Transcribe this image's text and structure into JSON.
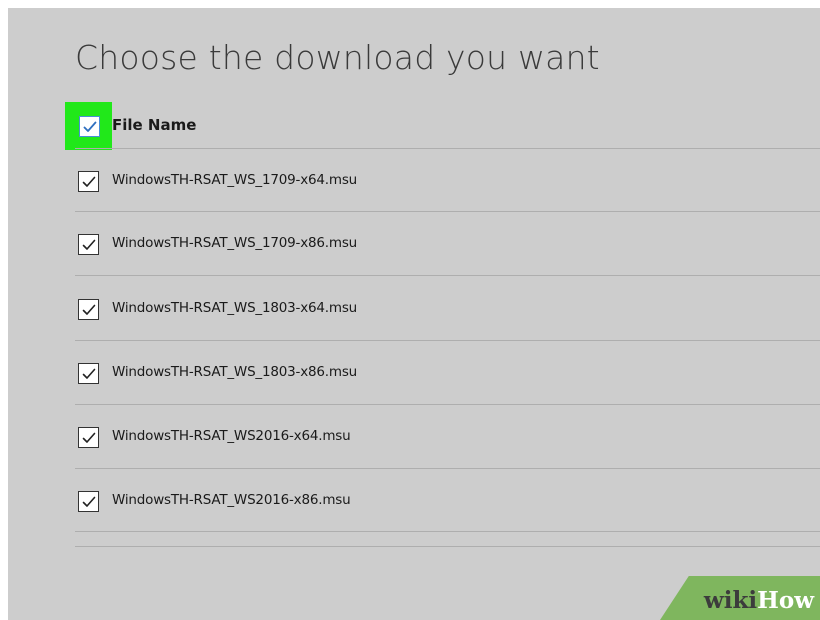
{
  "page": {
    "title": "Choose the download you want"
  },
  "table": {
    "header": {
      "label": "File Name",
      "checked": true
    },
    "rows": [
      {
        "label": "WindowsTH-RSAT_WS_1709-x64.msu",
        "checked": true
      },
      {
        "label": "WindowsTH-RSAT_WS_1709-x86.msu",
        "checked": true
      },
      {
        "label": "WindowsTH-RSAT_WS_1803-x64.msu",
        "checked": true
      },
      {
        "label": "WindowsTH-RSAT_WS_1803-x86.msu",
        "checked": true
      },
      {
        "label": "WindowsTH-RSAT_WS2016-x64.msu",
        "checked": true
      },
      {
        "label": "WindowsTH-RSAT_WS2016-x86.msu",
        "checked": true
      }
    ]
  },
  "watermark": {
    "part1": "wiki",
    "part2": "How"
  },
  "colors": {
    "panel_background": "#cdcdcd",
    "highlight": "#21e81a",
    "header_check_accent": "#4a8fd6",
    "watermark_green": "#7fb65e"
  },
  "icons": {
    "checkbox": "check-icon"
  }
}
